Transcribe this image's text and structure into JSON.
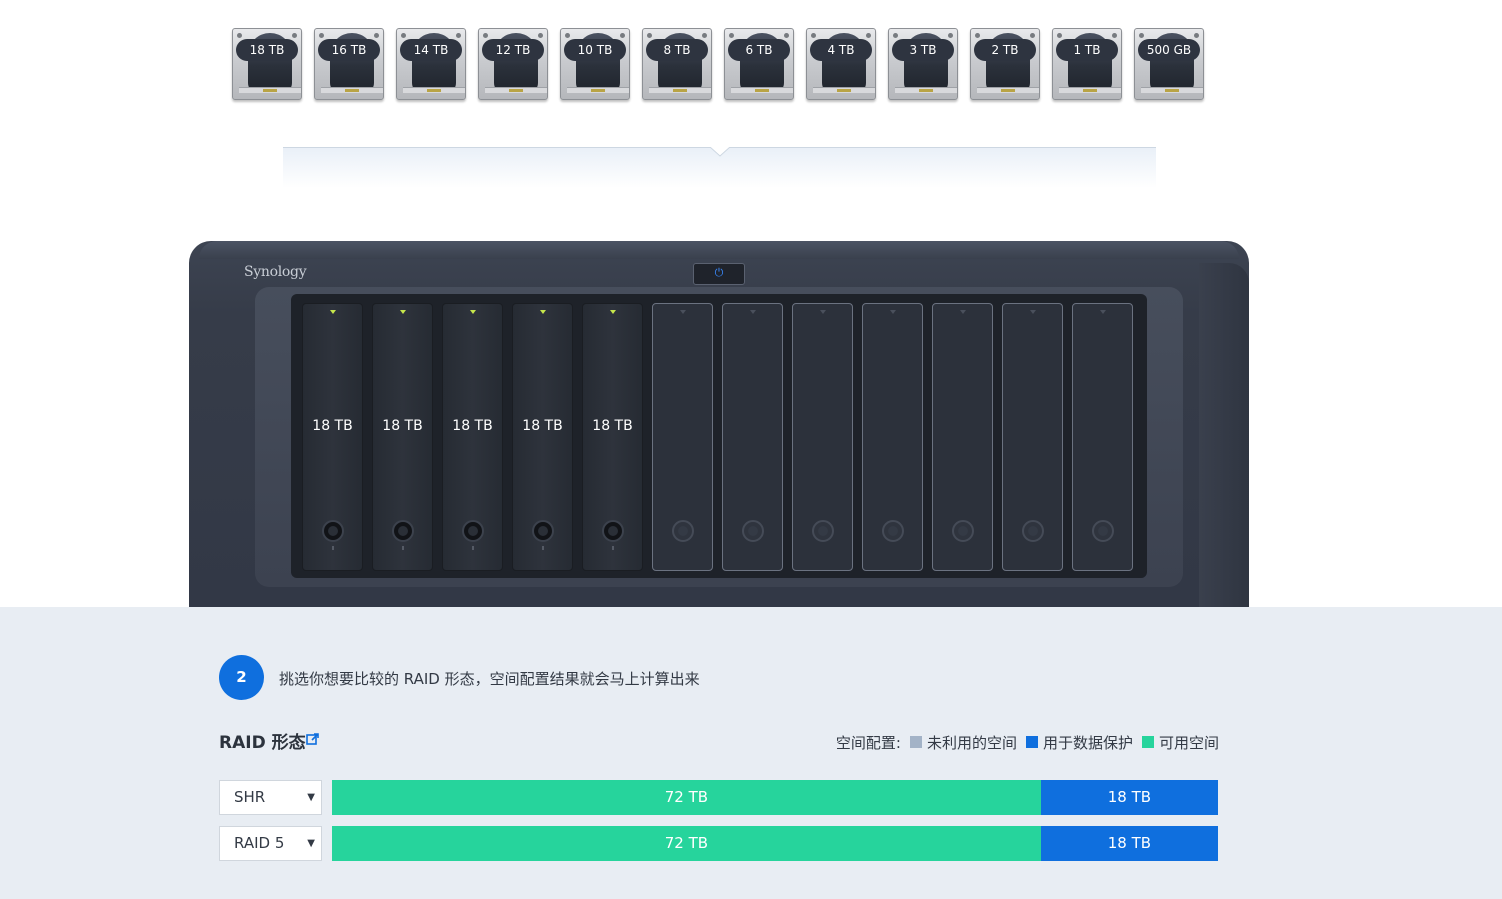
{
  "drive_picker": {
    "drives": [
      "18 TB",
      "16 TB",
      "14 TB",
      "12 TB",
      "10 TB",
      "8 TB",
      "6 TB",
      "4 TB",
      "3 TB",
      "2 TB",
      "1 TB",
      "500 GB"
    ]
  },
  "nas": {
    "brand": "Synology",
    "power_icon": "power-icon",
    "bays": [
      {
        "capacity": "18 TB",
        "filled": true
      },
      {
        "capacity": "18 TB",
        "filled": true
      },
      {
        "capacity": "18 TB",
        "filled": true
      },
      {
        "capacity": "18 TB",
        "filled": true
      },
      {
        "capacity": "18 TB",
        "filled": true
      },
      {
        "capacity": "",
        "filled": false
      },
      {
        "capacity": "",
        "filled": false
      },
      {
        "capacity": "",
        "filled": false
      },
      {
        "capacity": "",
        "filled": false
      },
      {
        "capacity": "",
        "filled": false
      },
      {
        "capacity": "",
        "filled": false
      },
      {
        "capacity": "",
        "filled": false
      }
    ]
  },
  "step": {
    "number": "2",
    "instruction": "挑选你想要比较的 RAID 形态，空间配置结果就会马上计算出来"
  },
  "raid": {
    "title": "RAID 形态",
    "external_link_icon": "external-link-icon"
  },
  "legend": {
    "label": "空间配置:",
    "items": [
      {
        "label": "未利用的空间",
        "color": "#a3b3c7"
      },
      {
        "label": "用于数据保护",
        "color": "#0f6fde"
      },
      {
        "label": "可用空间",
        "color": "#26d49c"
      }
    ]
  },
  "colors": {
    "available": "#26d49c",
    "protection": "#0f6fde",
    "unused": "#a3b3c7"
  },
  "rows": [
    {
      "raid_type": "SHR",
      "available": "72 TB",
      "protection": "18 TB",
      "available_fraction": 0.8,
      "protection_fraction": 0.2
    },
    {
      "raid_type": "RAID 5",
      "available": "72 TB",
      "protection": "18 TB",
      "available_fraction": 0.8,
      "protection_fraction": 0.2
    }
  ]
}
